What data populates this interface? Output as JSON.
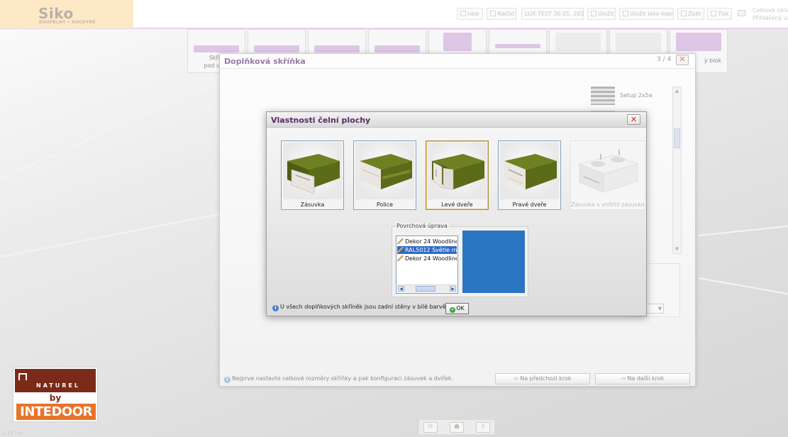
{
  "app": {
    "logo_text": "Siko",
    "logo_subtext": "KOUPELNY • KUCHYNĚ"
  },
  "toolbar": {
    "buttons": [
      {
        "label": "new"
      },
      {
        "label": "Načíst"
      },
      {
        "label": "LUX TEST 30.01. 201"
      },
      {
        "label": "Uložit"
      },
      {
        "label": "Uložit jako kopii"
      },
      {
        "label": "Zpět"
      },
      {
        "label": "Tisk"
      }
    ],
    "right_text_line1": "Celková cena",
    "right_text_line2": "Přihlášený uživ"
  },
  "catalog_strip": {
    "items": [
      {
        "label": "Skříň\npod umy"
      },
      {
        "label": ""
      },
      {
        "label": ""
      },
      {
        "label": ""
      },
      {
        "label": ""
      },
      {
        "label": ""
      },
      {
        "label": ""
      },
      {
        "label": ""
      },
      {
        "label": "ý blok"
      }
    ]
  },
  "wizard": {
    "title": "Doplňková skříňka",
    "step": "3 / 4",
    "setup_label": "Setup 2x5a",
    "info_text": "Nejprve nastavte celkové rozměry skříňky a pak konfiguraci zásuvek a dvířek.",
    "prev_button": "Na předchozí krok",
    "next_button": "Na další krok"
  },
  "modal": {
    "title": "Vlastnosti čelní plochy",
    "options": [
      {
        "label": "Zásuvka",
        "selected": false,
        "disabled": false
      },
      {
        "label": "Police",
        "selected": false,
        "disabled": false
      },
      {
        "label": "Levé dveře",
        "selected": true,
        "disabled": false
      },
      {
        "label": "Pravé dveře",
        "selected": false,
        "disabled": false
      },
      {
        "label": "Zásuvka s vnitřní zásuvkou",
        "selected": false,
        "disabled": true
      }
    ],
    "surface": {
      "legend": "Povrchová úprava",
      "items": [
        {
          "label": "Dekor 24 Woodline",
          "selected": false
        },
        {
          "label": "RAL5012 Světle modrá",
          "selected": true
        },
        {
          "label": "Dekor 24 Woodline",
          "selected": false
        }
      ],
      "swatch_color": "#2b74c2"
    },
    "info_text": "U všech doplňkových skříněk jsou zadní stěny v bílé barvě.",
    "ok_label": "OK"
  },
  "brand": {
    "top": "NATUREL",
    "by": "by",
    "bottom": "INTEDOOR"
  },
  "colors": {
    "accent_purple": "#5a2a66",
    "cabinet_green": "#5b6b18",
    "selection_blue": "#316ac5"
  },
  "status": {
    "coords": "1:23 :-8"
  }
}
